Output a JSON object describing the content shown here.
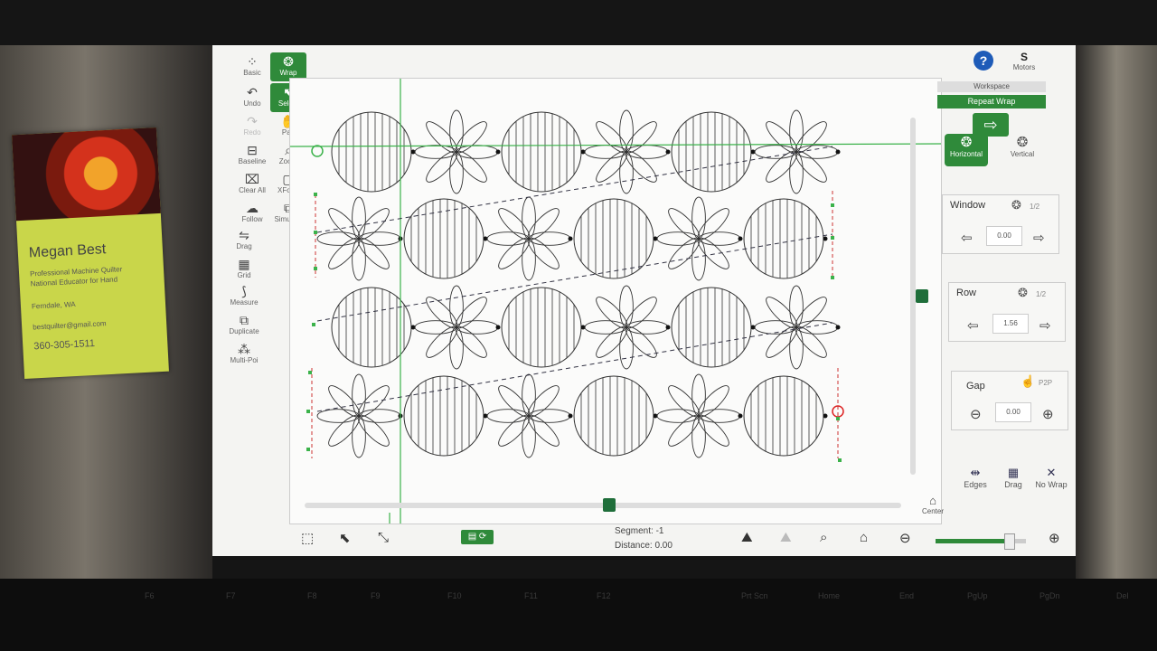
{
  "card": {
    "name": "Megan Best",
    "line1": "Professional Machine Quilter",
    "line2": "National Educator for Hand",
    "location": "Ferndale, WA",
    "email": "bestquilter@gmail.com",
    "phone": "360-305-1511"
  },
  "toolbar": [
    {
      "id": "basic",
      "label": "Basic",
      "icon": "grid-dots-icon",
      "glyph": "⁘",
      "active": false,
      "dim": false
    },
    {
      "id": "wrap",
      "label": "Wrap",
      "icon": "wrap-icon",
      "glyph": "❂",
      "active": true,
      "dim": false
    },
    {
      "id": "undo",
      "label": "Undo",
      "icon": "undo-icon",
      "glyph": "↶",
      "active": false,
      "dim": false
    },
    {
      "id": "select",
      "label": "Select",
      "icon": "select-icon",
      "glyph": "⬉",
      "active": true,
      "dim": false
    },
    {
      "id": "redo",
      "label": "Redo",
      "icon": "redo-icon",
      "glyph": "↷",
      "active": false,
      "dim": true
    },
    {
      "id": "pan",
      "label": "Pan",
      "icon": "hand-icon",
      "glyph": "✋",
      "active": false,
      "dim": false
    },
    {
      "id": "baseline",
      "label": "Baseline",
      "icon": "baseline-icon",
      "glyph": "⊟",
      "active": false,
      "dim": false
    },
    {
      "id": "zoom",
      "label": "Zoom",
      "icon": "zoom-icon",
      "glyph": "⌕",
      "active": false,
      "dim": false
    },
    {
      "id": "clearall",
      "label": "Clear All",
      "icon": "clear-icon",
      "glyph": "⌧",
      "active": false,
      "dim": false
    },
    {
      "id": "xform",
      "label": "XForm",
      "icon": "xform-icon",
      "glyph": "▢",
      "active": false,
      "dim": false
    },
    {
      "id": "follow",
      "label": "Follow",
      "icon": "follow-icon",
      "glyph": "☁",
      "active": false,
      "dim": false
    },
    {
      "id": "simulate",
      "label": "Simulate",
      "icon": "simulate-icon",
      "glyph": "⧉",
      "active": false,
      "dim": false
    },
    {
      "id": "drag",
      "label": "Drag",
      "icon": "drag-icon",
      "glyph": "⇋",
      "active": false,
      "dim": false
    },
    {
      "id": "grid",
      "label": "Grid",
      "icon": "grid-icon",
      "glyph": "▦",
      "active": false,
      "dim": false
    },
    {
      "id": "measure",
      "label": "Measure",
      "icon": "measure-icon",
      "glyph": "⟆",
      "active": false,
      "dim": false
    },
    {
      "id": "duplicate",
      "label": "Duplicate",
      "icon": "duplicate-icon",
      "glyph": "⧉",
      "active": false,
      "dim": false
    },
    {
      "id": "multipoint",
      "label": "Multi-Poi",
      "icon": "multi-point-icon",
      "glyph": "⁂",
      "active": false,
      "dim": false
    }
  ],
  "header": {
    "help": "?",
    "motors_label": "Motors",
    "motors_icon": "S"
  },
  "mode": {
    "workspace": "Workspace",
    "repeat_wrap": "Repeat Wrap",
    "horizontal": "Horizontal",
    "vertical": "Vertical"
  },
  "panels": {
    "window": {
      "title": "Window",
      "fraction": "1/2",
      "value": "0.00"
    },
    "row": {
      "title": "Row",
      "fraction": "1/2",
      "value": "1.56"
    },
    "gap": {
      "title": "Gap",
      "fraction": "P2P",
      "value": "0.00"
    }
  },
  "actions": {
    "edges": "Edges",
    "drag": "Drag",
    "nowrap": "No Wrap"
  },
  "center_label": "Center",
  "status": {
    "segment": "Segment: -1",
    "distance": "Distance: 0.00"
  },
  "keyboard": [
    "F6",
    "F7",
    "F8",
    "F9",
    "F10",
    "F11",
    "F12",
    "Prt Scn",
    "Home",
    "End",
    "PgUp",
    "PgDn",
    "Del"
  ]
}
